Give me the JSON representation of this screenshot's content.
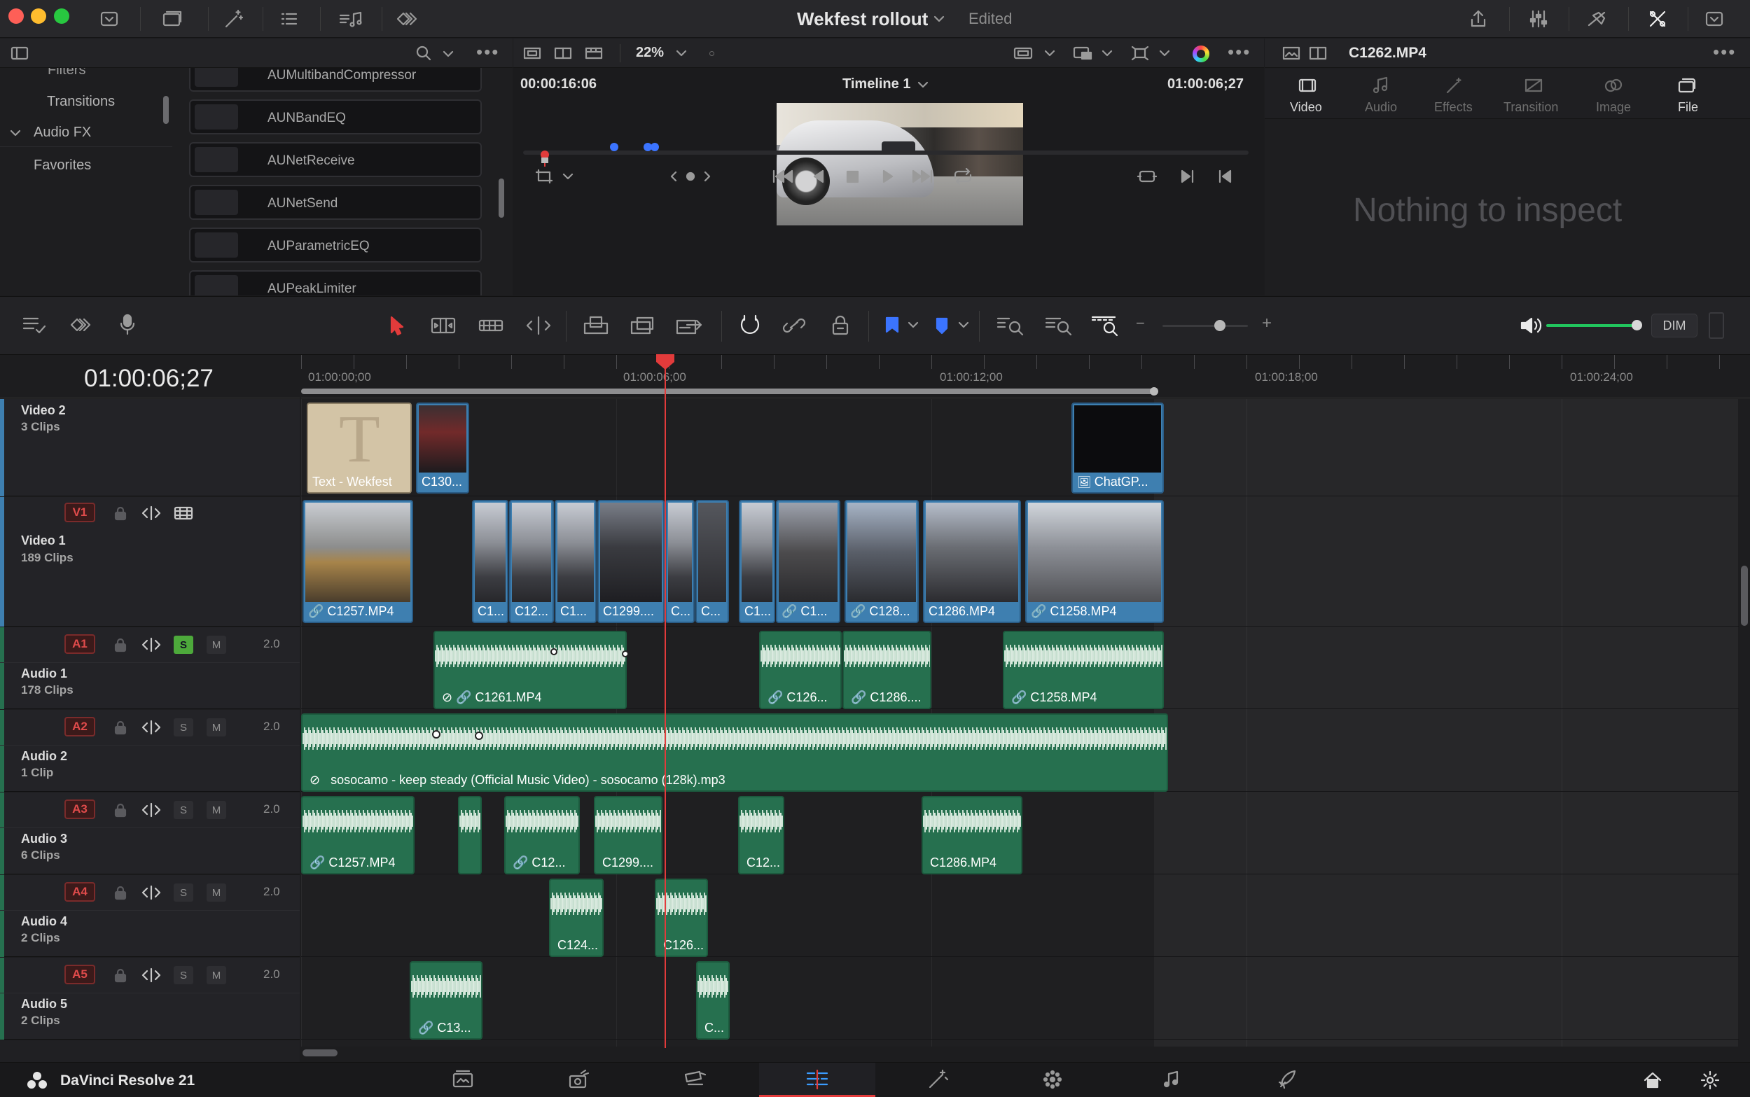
{
  "colors": {
    "accent_red": "#e23b3b",
    "video_clip": "#3e7fb0",
    "audio_clip": "#26704f",
    "volume_green": "#21c55d"
  },
  "titlebar": {
    "project_name": "Wekfest rollout",
    "status": "Edited"
  },
  "left_panel": {
    "tree": [
      {
        "label": "Filters"
      },
      {
        "label": "Transitions"
      },
      {
        "label": "Audio FX"
      },
      {
        "label": "Favorites"
      }
    ],
    "effects": [
      "AUMultibandCompressor",
      "AUNBandEQ",
      "AUNetReceive",
      "AUNetSend",
      "AUParametricEQ",
      "AUPeakLimiter"
    ]
  },
  "viewer": {
    "zoom": "22%",
    "source_timecode": "00:00:16:06",
    "timeline_name": "Timeline 1",
    "record_timecode": "01:00:06;27"
  },
  "inspector": {
    "clip_name": "C1262.MP4",
    "tabs": [
      {
        "label": "Video",
        "icon": "film-icon"
      },
      {
        "label": "Audio",
        "icon": "music-note-icon"
      },
      {
        "label": "Effects",
        "icon": "wand-icon"
      },
      {
        "label": "Transition",
        "icon": "transition-icon"
      },
      {
        "label": "Image",
        "icon": "image-icon"
      },
      {
        "label": "File",
        "icon": "file-icon"
      }
    ],
    "empty_message": "Nothing to inspect"
  },
  "toolbar": {
    "dim_label": "DIM"
  },
  "timeline": {
    "current_timecode": "01:00:06;27",
    "ruler": [
      "01:00:00;00",
      "01:00:06;00",
      "01:00:12;00",
      "01:00:18;00",
      "01:00:24;00"
    ],
    "tracks": {
      "video2": {
        "name": "Video 2",
        "count": "3 Clips"
      },
      "video1": {
        "badge": "V1",
        "name": "Video 1",
        "count": "189 Clips"
      },
      "audio1": {
        "badge": "A1",
        "name": "Audio 1",
        "count": "178 Clips",
        "solo": "S",
        "mute": "M",
        "level": "2.0"
      },
      "audio2": {
        "badge": "A2",
        "name": "Audio 2",
        "count": "1 Clip",
        "solo": "S",
        "mute": "M",
        "level": "2.0"
      },
      "audio3": {
        "badge": "A3",
        "name": "Audio 3",
        "count": "6 Clips",
        "solo": "S",
        "mute": "M",
        "level": "2.0"
      },
      "audio4": {
        "badge": "A4",
        "name": "Audio 4",
        "count": "2 Clips",
        "solo": "S",
        "mute": "M",
        "level": "2.0"
      },
      "audio5": {
        "badge": "A5",
        "name": "Audio 5",
        "count": "2 Clips",
        "solo": "S",
        "mute": "M",
        "level": "2.0"
      }
    },
    "clips": {
      "v2": [
        "Text - Wekfest",
        "C130...",
        "ChatGP..."
      ],
      "v1": [
        "C1257.MP4",
        "C1...",
        "C12...",
        "C1...",
        "C1299....",
        "C...",
        "C...",
        "C1...",
        "C1...",
        "C128...",
        "C1286.MP4",
        "C1258.MP4"
      ],
      "a1": [
        "C1261.MP4",
        "C126...",
        "C1286....",
        "C1258.MP4"
      ],
      "a2": [
        "sosocamo - keep steady (Official Music Video) - sosocamo (128k).mp3"
      ],
      "a3": [
        "C1257.MP4",
        "C12...",
        "C1299....",
        "C12...",
        "C1286.MP4"
      ],
      "a4": [
        "C124...",
        "C126..."
      ],
      "a5": [
        "C13...",
        "C..."
      ]
    }
  },
  "footer": {
    "app_name": "DaVinci Resolve 21",
    "pages": [
      "media-page-icon",
      "cut-page-icon",
      "edit-page-icon",
      "timeline-page-icon",
      "fusion-page-icon",
      "color-page-icon",
      "fairlight-page-icon",
      "deliver-page-icon"
    ]
  }
}
